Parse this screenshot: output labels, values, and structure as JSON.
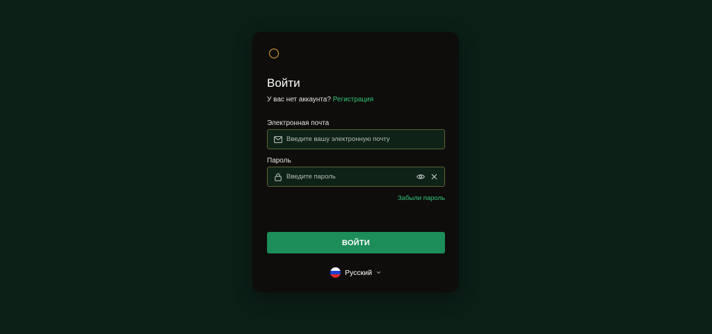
{
  "login": {
    "title": "Войти",
    "no_account_text": "У вас нет аккаунта?",
    "signup_link": "Регистрация",
    "email_label": "Электронная почта",
    "email_placeholder": "Введите вашу электронную почту",
    "email_value": "",
    "password_label": "Пароль",
    "password_placeholder": "Введите пароль",
    "password_value": "",
    "forgot_link": "Забыли пароль",
    "submit_label": "ВОЙТИ"
  },
  "language": {
    "selected": "Русский",
    "flag_colors": [
      "#ffffff",
      "#1c3fd1",
      "#e0262d"
    ]
  },
  "icons": {
    "logo": "circle-logo-icon",
    "email": "mail-icon",
    "password": "lock-icon",
    "toggle_visibility": "eye-icon",
    "clear": "close-icon",
    "language_caret": "chevron-down-icon"
  },
  "colors": {
    "page_background": "#0b1f17",
    "card_background": "#0e0d0b",
    "accent_green": "#34c178",
    "button_green": "#1d8e59",
    "logo_orange": "#e8a93a",
    "field_border": "#5a6430"
  }
}
